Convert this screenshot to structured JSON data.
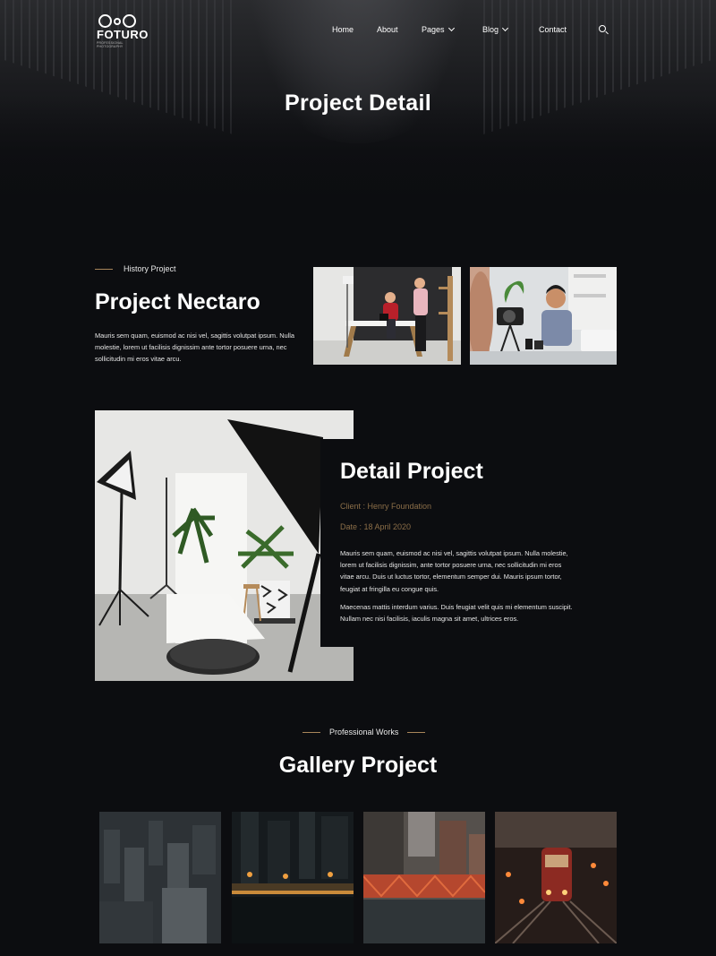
{
  "brand": {
    "name": "FOTURO",
    "tagline": "PROFESSIONAL PHOTOGRAPHY"
  },
  "nav": {
    "home": "Home",
    "about": "About",
    "pages": "Pages",
    "blog": "Blog",
    "contact": "Contact"
  },
  "hero": {
    "title": "Project Detail"
  },
  "history": {
    "eyebrow": "History Project",
    "title": "Project Nectaro",
    "body": "Mauris sem quam, euismod ac nisi vel, sagittis volutpat ipsum. Nulla molestie, lorem ut facilisis dignissim ante tortor posuere urna, nec sollicitudin mi eros vitae arcu."
  },
  "detail": {
    "title": "Detail Project",
    "client": "Client : Henry Foundation",
    "date": "Date : 18 April 2020",
    "para1": "Mauris sem quam, euismod ac nisi vel, sagittis volutpat ipsum. Nulla molestie, lorem ut facilisis dignissim, ante tortor posuere urna, nec sollicitudin mi eros vitae arcu. Duis ut luctus tortor, elementum semper dui. Mauris ipsum tortor, feugiat at fringilla eu  congue quis.",
    "para2": "Maecenas mattis interdum varius. Duis feugiat velit quis mi elementum suscipit. Nullam nec nisi facilisis, iaculis magna sit amet, ultrices eros."
  },
  "gallery": {
    "eyebrow": "Professional Works",
    "title": "Gallery Project"
  },
  "colors": {
    "background": "#0c0d10",
    "accent": "#a8855a",
    "meta_text": "#8b6e48"
  }
}
